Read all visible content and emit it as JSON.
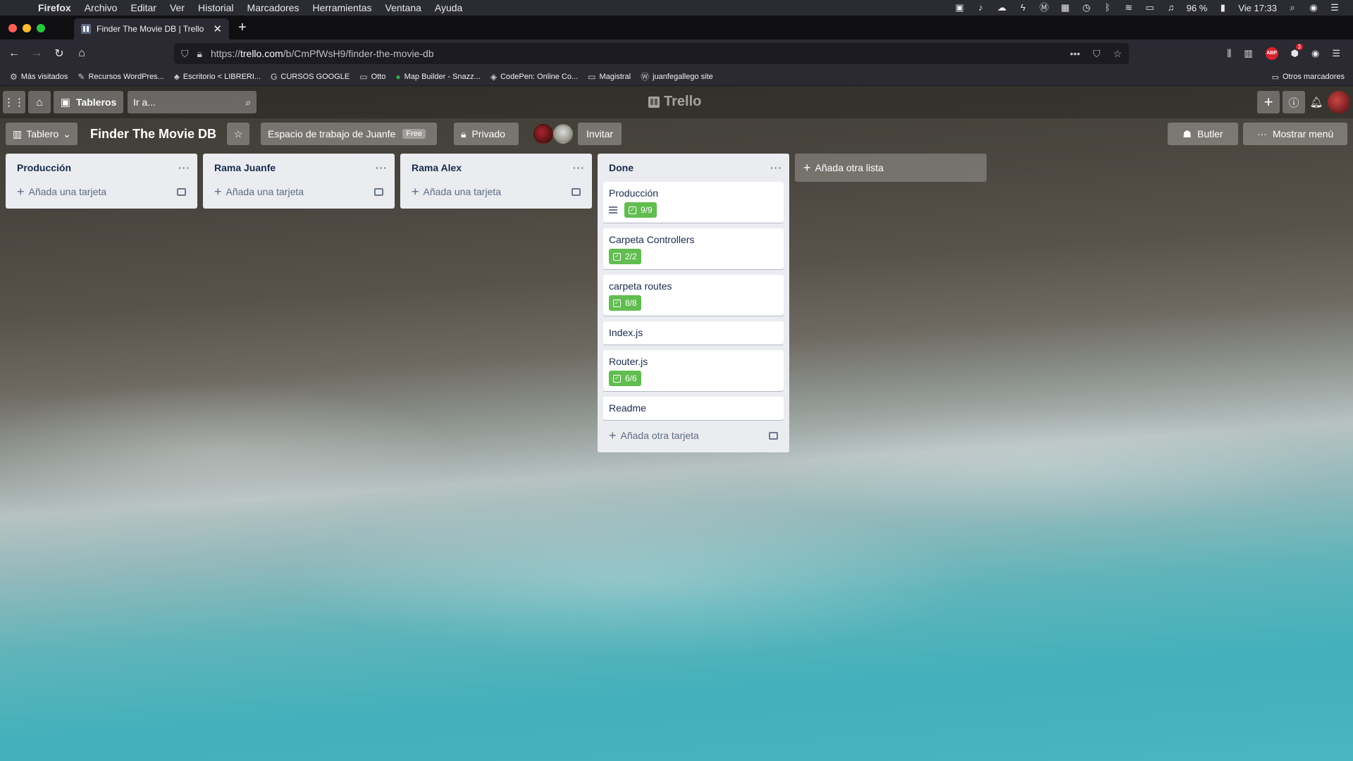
{
  "menubar": {
    "app": "Firefox",
    "menus": [
      "Archivo",
      "Editar",
      "Ver",
      "Historial",
      "Marcadores",
      "Herramientas",
      "Ventana",
      "Ayuda"
    ],
    "battery": "96 %",
    "clock": "Vie 17:33"
  },
  "browser": {
    "tab_title": "Finder The Movie DB | Trello",
    "url_prefix": "https://",
    "url_host": "trello.com",
    "url_path": "/b/CmPfWsH9/finder-the-movie-db",
    "adblock_label": "ABP",
    "notif_count": "3",
    "bookmarks": [
      {
        "label": "Más visitados",
        "icon": "gear-icon"
      },
      {
        "label": "Recursos WordPres...",
        "icon": "wrench-icon"
      },
      {
        "label": "Escritorio < LIBRERI...",
        "icon": "leaf-icon"
      },
      {
        "label": "CURSOS GOOGLE",
        "icon": "google-icon"
      },
      {
        "label": "Otto",
        "icon": "folder-icon"
      },
      {
        "label": "Map Builder - Snazz...",
        "icon": "map-pin-icon"
      },
      {
        "label": "CodePen: Online Co...",
        "icon": "codepen-icon"
      },
      {
        "label": "Magistral",
        "icon": "folder-icon"
      },
      {
        "label": "juanfegallego site",
        "icon": "wordpress-icon"
      }
    ],
    "other_bookmarks": "Otros marcadores"
  },
  "trello": {
    "boards_label": "Tableros",
    "search_placeholder": "Ir a...",
    "logo_text": "Trello",
    "board": {
      "view_label": "Tablero",
      "title": "Finder The Movie DB",
      "workspace": "Espacio de trabajo de Juanfe",
      "workspace_badge": "Free",
      "visibility": "Privado",
      "invite": "Invitar",
      "butler": "Butler",
      "menu": "Mostrar menú"
    },
    "lists": [
      {
        "title": "Producción",
        "add_label": "Añada una tarjeta",
        "cards": []
      },
      {
        "title": "Rama Juanfe",
        "add_label": "Añada una tarjeta",
        "cards": []
      },
      {
        "title": "Rama Alex",
        "add_label": "Añada una tarjeta",
        "cards": []
      },
      {
        "title": "Done",
        "add_label": "Añada otra tarjeta",
        "cards": [
          {
            "title": "Producción",
            "checklist": "9/9",
            "has_description": true
          },
          {
            "title": "Carpeta Controllers",
            "checklist": "2/2"
          },
          {
            "title": "carpeta routes",
            "checklist": "8/8"
          },
          {
            "title": "Index.js"
          },
          {
            "title": "Router.js",
            "checklist": "6/6"
          },
          {
            "title": "Readme"
          }
        ]
      }
    ],
    "add_list_label": "Añada otra lista"
  },
  "colors": {
    "checklist_complete": "#61bd4f",
    "list_bg": "#ebecf0"
  }
}
